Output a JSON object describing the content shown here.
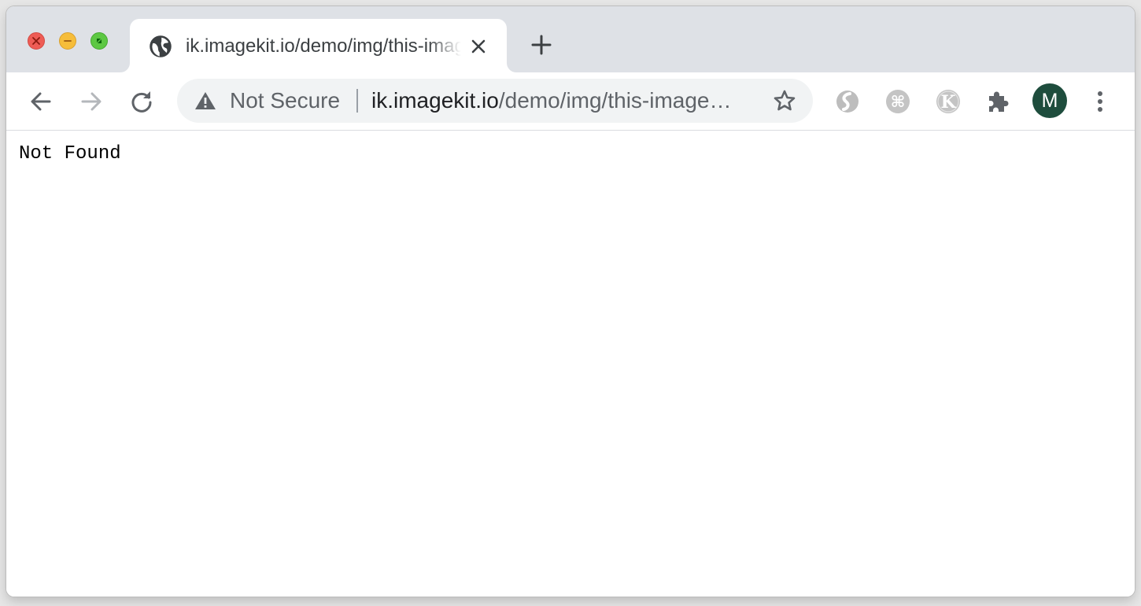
{
  "tab": {
    "title": "ik.imagekit.io/demo/img/this-image-does-not-exist.jpg",
    "favicon": "globe-icon"
  },
  "toolbar": {
    "security_label": "Not Secure",
    "url_host": "ik.imagekit.io",
    "url_path": "/demo/img/this-image…",
    "back_icon": "arrow-left-icon",
    "forward_icon": "arrow-right-icon",
    "reload_icon": "reload-icon",
    "bookmark_icon": "star-outline-icon"
  },
  "extensions": [
    {
      "name": "grey-s-extension-icon"
    },
    {
      "name": "command-key-extension-icon",
      "glyph": "⌘"
    },
    {
      "name": "k-extension-icon",
      "glyph": "K"
    },
    {
      "name": "puzzle-extensions-icon"
    }
  ],
  "profile": {
    "initial": "M",
    "color": "#1e4d3d"
  },
  "page": {
    "body_text": "Not Found"
  },
  "colors": {
    "tabstrip": "#dee1e6",
    "omnibox": "#f1f3f4",
    "traffic_close": "#ee5c55",
    "traffic_minimize": "#f6bd3a",
    "traffic_maximize": "#5dc843"
  }
}
